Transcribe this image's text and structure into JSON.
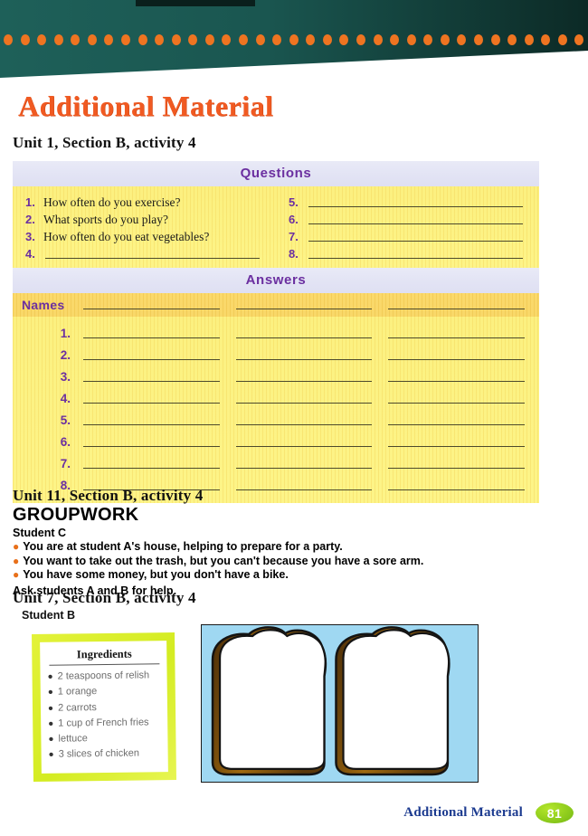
{
  "header": {
    "title": "Additional Material",
    "banner_color": "#1a5650",
    "dot_color": "#ee7421",
    "title_color": "#f05a22",
    "dot_count": 35
  },
  "sections": [
    {
      "heading": "Unit 1, Section B, activity 4",
      "questions_panel": {
        "band_label": "Questions",
        "left_column": [
          {
            "num": "1.",
            "text": "How often do you exercise?",
            "has_line": false
          },
          {
            "num": "2.",
            "text": "What sports do you play?",
            "has_line": false
          },
          {
            "num": "3.",
            "text": "How often do you eat vegetables?",
            "has_line": false
          },
          {
            "num": "4.",
            "text": "",
            "has_line": true
          }
        ],
        "right_column": [
          {
            "num": "5.",
            "text": "",
            "has_line": true
          },
          {
            "num": "6.",
            "text": "",
            "has_line": true
          },
          {
            "num": "7.",
            "text": "",
            "has_line": true
          },
          {
            "num": "8.",
            "text": "",
            "has_line": true
          }
        ]
      },
      "answers_panel": {
        "band_label": "Answers",
        "names_label": "Names",
        "column_count": 3,
        "row_numbers": [
          "1.",
          "2.",
          "3.",
          "4.",
          "5.",
          "6.",
          "7.",
          "8."
        ]
      }
    },
    {
      "heading": "Unit 11, Section B, activity 4",
      "groupwork": {
        "title": "GROUPWORK",
        "student": "Student C",
        "bullets": [
          "You are at student A's house, helping to prepare for a party.",
          "You want to take out the trash, but you can't because you have a sore arm.",
          "You have some money, but you don't have a bike."
        ],
        "footer": "Ask students A and B for help."
      }
    },
    {
      "heading": "Unit 7, Section B, activity 4",
      "student": "Student B",
      "ingredients_card": {
        "title": "Ingredients",
        "items": [
          "2 teaspoons of relish",
          "1 orange",
          "2 carrots",
          "1 cup of French fries",
          "lettuce",
          "3 slices of chicken"
        ],
        "border_color": "#d4ec22"
      },
      "illustration": {
        "name": "two-bread-slices",
        "background_color": "#9fd8f2",
        "crust_color": "#7a4a12",
        "bread_color": "#ffffff"
      }
    }
  ],
  "footer": {
    "label": "Additional Material",
    "page_number": "81",
    "badge_color": "#86c61a",
    "label_color": "#1b3a8f"
  }
}
